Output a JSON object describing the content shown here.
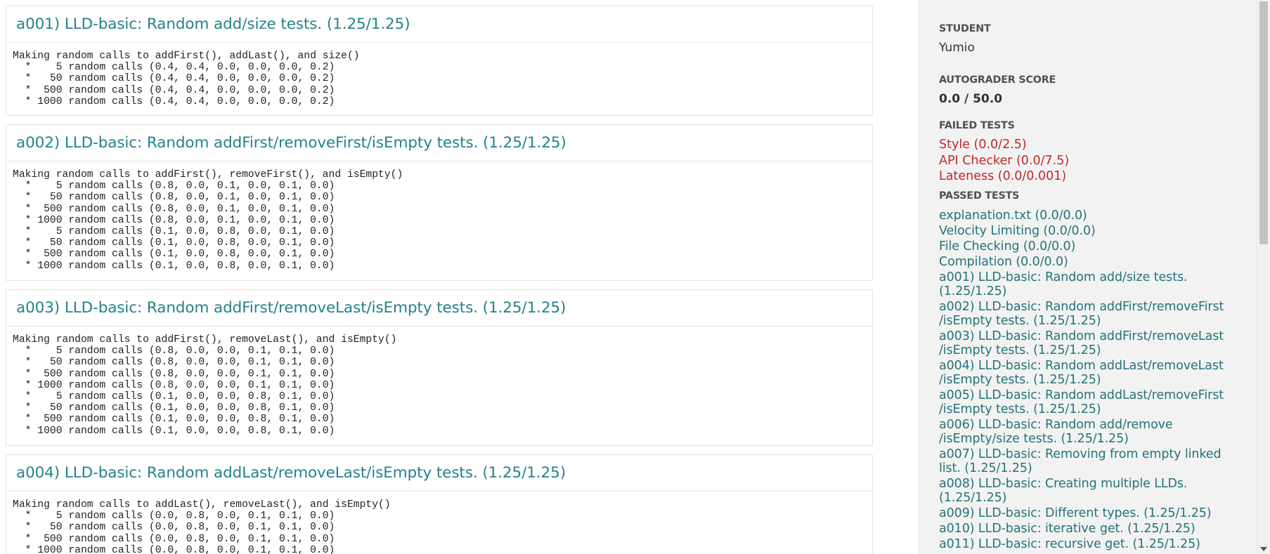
{
  "tests": [
    {
      "title": "a001) LLD-basic: Random add/size tests. (1.25/1.25)",
      "output": "Making random calls to addFirst(), addLast(), and size()\n  *    5 random calls (0.4, 0.4, 0.0, 0.0, 0.0, 0.2)\n  *   50 random calls (0.4, 0.4, 0.0, 0.0, 0.0, 0.2)\n  *  500 random calls (0.4, 0.4, 0.0, 0.0, 0.0, 0.2)\n  * 1000 random calls (0.4, 0.4, 0.0, 0.0, 0.0, 0.2)"
    },
    {
      "title": "a002) LLD-basic: Random addFirst/removeFirst/isEmpty tests. (1.25/1.25)",
      "output": "Making random calls to addFirst(), removeFirst(), and isEmpty()\n  *    5 random calls (0.8, 0.0, 0.1, 0.0, 0.1, 0.0)\n  *   50 random calls (0.8, 0.0, 0.1, 0.0, 0.1, 0.0)\n  *  500 random calls (0.8, 0.0, 0.1, 0.0, 0.1, 0.0)\n  * 1000 random calls (0.8, 0.0, 0.1, 0.0, 0.1, 0.0)\n  *    5 random calls (0.1, 0.0, 0.8, 0.0, 0.1, 0.0)\n  *   50 random calls (0.1, 0.0, 0.8, 0.0, 0.1, 0.0)\n  *  500 random calls (0.1, 0.0, 0.8, 0.0, 0.1, 0.0)\n  * 1000 random calls (0.1, 0.0, 0.8, 0.0, 0.1, 0.0)"
    },
    {
      "title": "a003) LLD-basic: Random addFirst/removeLast/isEmpty tests. (1.25/1.25)",
      "output": "Making random calls to addFirst(), removeLast(), and isEmpty()\n  *    5 random calls (0.8, 0.0, 0.0, 0.1, 0.1, 0.0)\n  *   50 random calls (0.8, 0.0, 0.0, 0.1, 0.1, 0.0)\n  *  500 random calls (0.8, 0.0, 0.0, 0.1, 0.1, 0.0)\n  * 1000 random calls (0.8, 0.0, 0.0, 0.1, 0.1, 0.0)\n  *    5 random calls (0.1, 0.0, 0.0, 0.8, 0.1, 0.0)\n  *   50 random calls (0.1, 0.0, 0.0, 0.8, 0.1, 0.0)\n  *  500 random calls (0.1, 0.0, 0.0, 0.8, 0.1, 0.0)\n  * 1000 random calls (0.1, 0.0, 0.0, 0.8, 0.1, 0.0)"
    },
    {
      "title": "a004) LLD-basic: Random addLast/removeLast/isEmpty tests. (1.25/1.25)",
      "output": "Making random calls to addLast(), removeLast(), and isEmpty()\n  *    5 random calls (0.0, 0.8, 0.0, 0.1, 0.1, 0.0)\n  *   50 random calls (0.0, 0.8, 0.0, 0.1, 0.1, 0.0)\n  *  500 random calls (0.0, 0.8, 0.0, 0.1, 0.1, 0.0)\n  * 1000 random calls (0.0, 0.8, 0.0, 0.1, 0.1, 0.0)"
    }
  ],
  "sidebar": {
    "student_label": "STUDENT",
    "student_name": "Yumio",
    "score_label": "AUTOGRADER SCORE",
    "score_value": "0.0 / 50.0",
    "failed_label": "FAILED TESTS",
    "failed_tests": [
      "Style (0.0/2.5)",
      "API Checker (0.0/7.5)",
      "Lateness (0.0/0.001)"
    ],
    "passed_label": "PASSED TESTS",
    "passed_tests": [
      "explanation.txt (0.0/0.0)",
      "Velocity Limiting (0.0/0.0)",
      "File Checking (0.0/0.0)",
      "Compilation (0.0/0.0)",
      "a001) LLD-basic: Random add/size tests. (1.25/1.25)",
      "a002) LLD-basic: Random addFirst/removeFirst /isEmpty tests. (1.25/1.25)",
      "a003) LLD-basic: Random addFirst/removeLast /isEmpty tests. (1.25/1.25)",
      "a004) LLD-basic: Random addLast/removeLast /isEmpty tests. (1.25/1.25)",
      "a005) LLD-basic: Random addLast/removeFirst /isEmpty tests. (1.25/1.25)",
      "a006) LLD-basic: Random add/remove /isEmpty/size tests. (1.25/1.25)",
      "a007) LLD-basic: Removing from empty linked list. (1.25/1.25)",
      "a008) LLD-basic: Creating multiple LLDs. (1.25/1.25)",
      "a009) LLD-basic: Different types. (1.25/1.25)",
      "a010) LLD-basic: iterative get. (1.25/1.25)",
      "a011) LLD-basic: recursive get. (1.25/1.25)"
    ]
  },
  "colors": {
    "accent_teal": "#23828a",
    "failed_red": "#c0282d",
    "sidebar_bg": "#f2f2f2"
  }
}
